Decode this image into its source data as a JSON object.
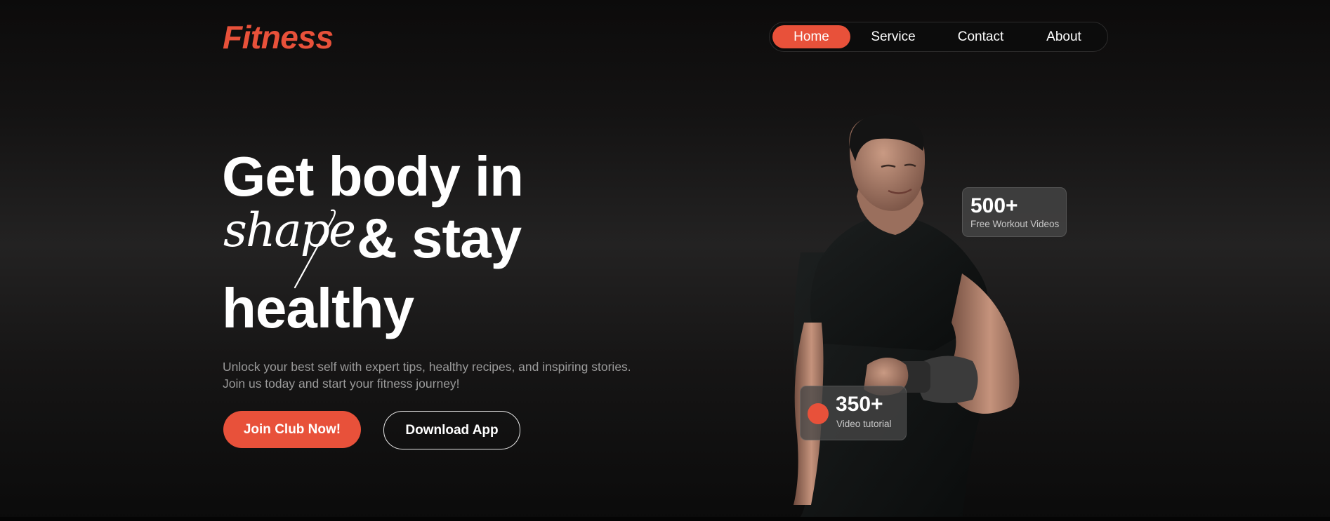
{
  "brand": {
    "logo": "Fitness",
    "accent_color": "#e8513a"
  },
  "nav": {
    "items": [
      {
        "label": "Home",
        "active": true
      },
      {
        "label": "Service",
        "active": false
      },
      {
        "label": "Contact",
        "active": false
      },
      {
        "label": "About",
        "active": false
      }
    ]
  },
  "hero": {
    "line1": "Get body in",
    "script_word": "shape",
    "line2": "& stay",
    "line3": "healthy",
    "subtext_line1": "Unlock your best self with expert tips, healthy recipes, and inspiring stories.",
    "subtext_line2": "Join us today and start your fitness journey!",
    "primary_button": "Join Club Now!",
    "secondary_button": "Download App"
  },
  "stats": {
    "videos": {
      "value": "500+",
      "label": "Free Workout Videos"
    },
    "tutorial": {
      "value": "350+",
      "label": "Video tutorial",
      "icon": "record-dot-icon"
    }
  },
  "image": {
    "subject": "athlete-photo"
  }
}
